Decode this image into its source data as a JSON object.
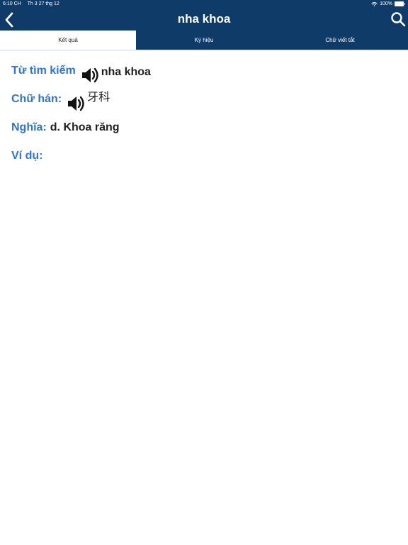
{
  "status_bar": {
    "time": "6:10 CH",
    "date": "Th 3 27 thg 12",
    "battery": "100%"
  },
  "nav": {
    "title": "nha khoa",
    "back_icon": "chevron-left-icon",
    "search_icon": "search-icon"
  },
  "tabs": [
    {
      "label": "Kết quả",
      "active": true
    },
    {
      "label": "Ký hiệu",
      "active": false
    },
    {
      "label": "Chữ viết tắt",
      "active": false
    }
  ],
  "entry": {
    "search_word_label": "Từ tìm kiếm",
    "search_word_value": "nha khoa",
    "han_label": "Chữ hán:",
    "han_value": "牙科",
    "meaning_label": "Nghĩa:",
    "meaning_value": "d. Khoa răng",
    "example_label": "Ví dụ:"
  },
  "colors": {
    "header_bg": "#0f3b69",
    "label": "#2f74d0",
    "text": "#1f1f1f"
  }
}
